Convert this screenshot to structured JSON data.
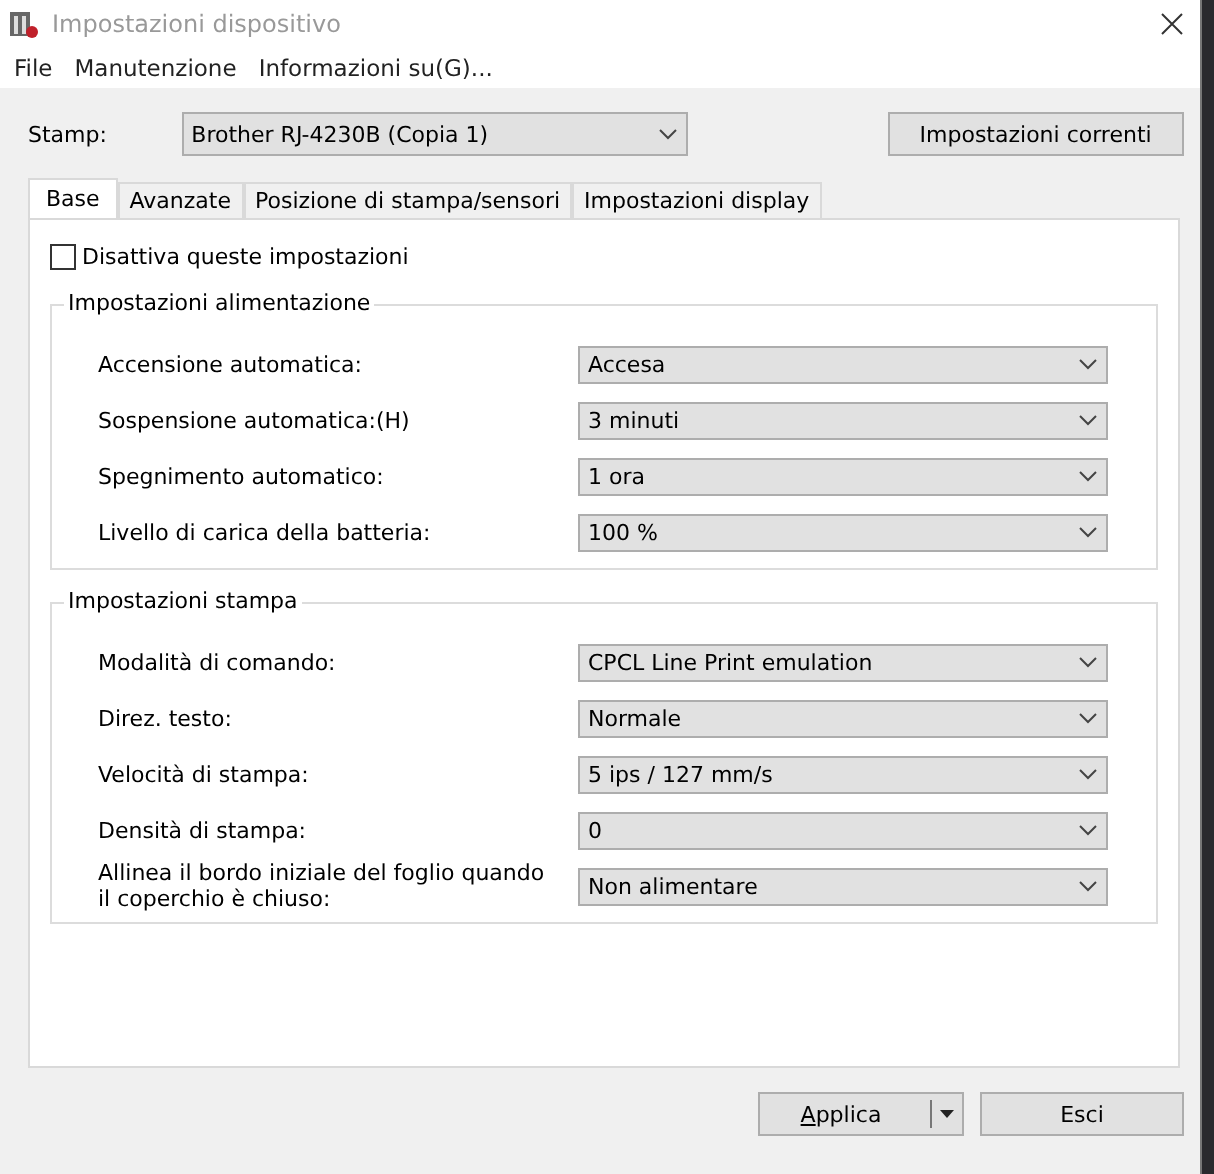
{
  "window": {
    "title": "Impostazioni dispositivo"
  },
  "menu": [
    "File",
    "Manutenzione",
    "Informazioni su(G)..."
  ],
  "printer": {
    "label": "Stamp:",
    "value": "Brother RJ-4230B (Copia 1)"
  },
  "current_settings_button": "Impostazioni correnti",
  "tabs": [
    {
      "label": "Base",
      "selected": true
    },
    {
      "label": "Avanzate",
      "selected": false
    },
    {
      "label": "Posizione di stampa/sensori",
      "selected": false
    },
    {
      "label": "Impostazioni display",
      "selected": false
    }
  ],
  "disable_checkbox": {
    "label": "Disattiva queste impostazioni",
    "checked": false
  },
  "groups": [
    {
      "title": "Impostazioni alimentazione",
      "rows": [
        {
          "label": "Accensione automatica:",
          "value": "Accesa"
        },
        {
          "label": "Sospensione automatica:(H)",
          "value": "3 minuti"
        },
        {
          "label": "Spegnimento automatico:",
          "value": "1 ora"
        },
        {
          "label": "Livello di carica della batteria:",
          "value": "100 %"
        }
      ]
    },
    {
      "title": "Impostazioni stampa",
      "rows": [
        {
          "label": "Modalità di comando:",
          "value": "CPCL Line Print emulation"
        },
        {
          "label": "Direz. testo:",
          "value": "Normale"
        },
        {
          "label": "Velocità di stampa:",
          "value": "5 ips / 127 mm/s"
        },
        {
          "label": "Densità di stampa:",
          "value": "0"
        },
        {
          "label": "Allinea il bordo iniziale del foglio quando il coperchio è chiuso:",
          "value": "Non alimentare"
        }
      ]
    }
  ],
  "buttons": {
    "apply": "Applica",
    "exit": "Esci"
  }
}
